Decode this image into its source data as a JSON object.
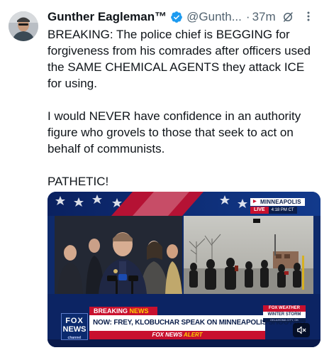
{
  "tweet": {
    "author_name": "Gunther Eagleman™",
    "handle": "@Gunth...",
    "separator": "·",
    "time_ago": "37m",
    "body": "BREAKING: The police chief is BEGGING for forgiveness from his comrades after officers used the SAME CHEMICAL AGENTS they attack ICE for using.\n\nI would NEVER have confidence in an authority figure who grovels to those that seek to act on behalf of communists.\n\nPATHETIC!"
  },
  "icons": {
    "verified": "verified-badge-icon",
    "grok": "grok-icon",
    "more": "more-icon",
    "mute": "speaker-muted-icon"
  },
  "media": {
    "live_badge": {
      "location": "MINNEAPOLIS",
      "live": "LIVE",
      "time": "4:18 PM CT"
    },
    "chyron": {
      "breaking_prefix": "BREAKING ",
      "breaking_news": "NEWS",
      "headline": "NOW: FREY, KLOBUCHAR SPEAK ON MINNEAPOLIS SHOOTING",
      "alert_prefix": "FOX NEWS ",
      "alert_word": "ALERT"
    },
    "network_logo": {
      "line1": "FOX",
      "line2": "NEWS",
      "line3": "channel"
    },
    "weather": {
      "label": "FOX WEATHER",
      "title": "WINTER STORM",
      "subtitle": "OKLAHOMA CITY, OK"
    }
  },
  "colors": {
    "verified_blue": "#1d9bf0",
    "text_primary": "#0f1419",
    "text_secondary": "#536471",
    "fox_red": "#c8102e",
    "fox_navy": "#0b1e4a"
  }
}
